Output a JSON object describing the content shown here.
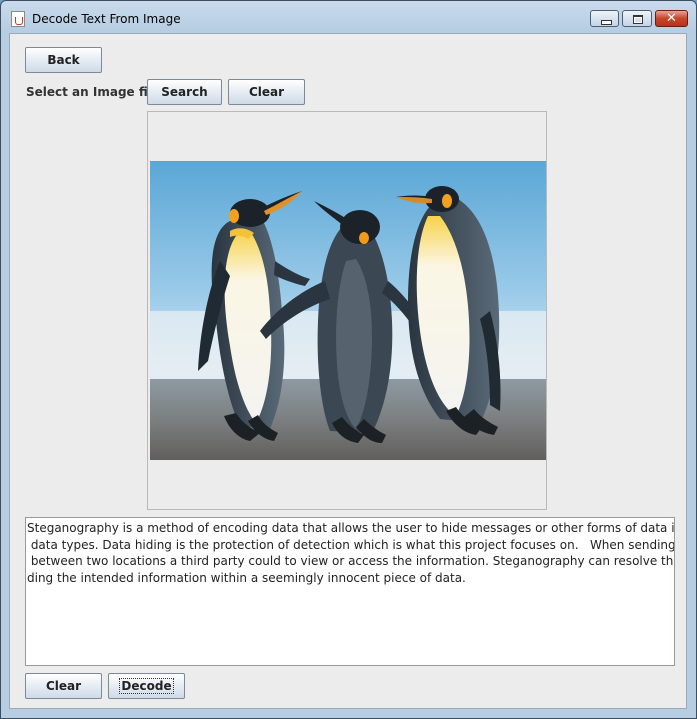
{
  "window": {
    "title": "Decode Text From Image"
  },
  "controls": {
    "back_label": "Back",
    "select_label": "Select an Image file",
    "search_label": "Search",
    "clear_top_label": "Clear",
    "clear_bottom_label": "Clear",
    "decode_label": "Decode"
  },
  "image": {
    "subject": "penguins-photo"
  },
  "message": {
    "lines": [
      "Steganography is a method of encoding data that allows the user to hide messages or other forms of data inside other",
      " data types. Data hiding is the protection of detection which is what this project focuses on.   When sending information",
      " between two locations a third party could to view or access the information. Steganography can resolve this issue by hi",
      "ding the intended information within a seemingly innocent piece of data."
    ]
  }
}
